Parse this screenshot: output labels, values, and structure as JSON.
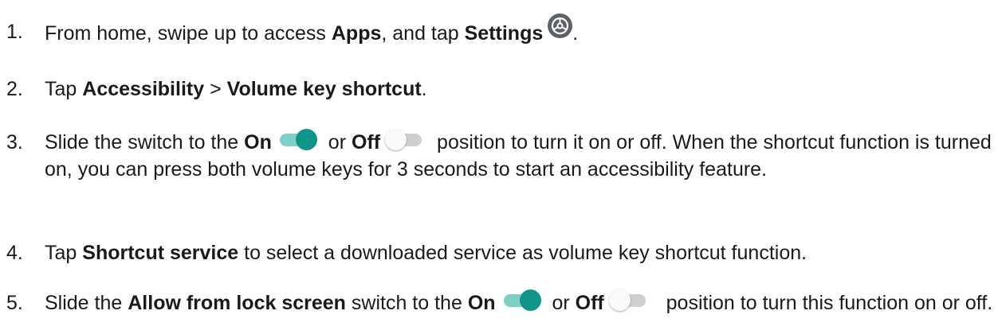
{
  "steps": [
    {
      "number": "1.",
      "t1": "From home, swipe up to access ",
      "b1": "Apps",
      "t2": ", and tap ",
      "b2": "Settings",
      "icon": "settings-gear-icon",
      "t3": "."
    },
    {
      "number": "2.",
      "t1": "Tap ",
      "b1": "Accessibility",
      "t2": " > ",
      "b2": "Volume key shortcut",
      "t3": "."
    },
    {
      "number": "3.",
      "t1": "Slide the switch to the ",
      "b1": "On",
      "t2": " or ",
      "b2": "Off",
      "t3": " position to turn it on or off. When the shortcut function is turned on, you can press both volume keys for 3 seconds to start an accessibility feature."
    },
    {
      "number": "4.",
      "t1": "Tap ",
      "b1": "Shortcut service",
      "t2": " to select a downloaded service as volume key shortcut function."
    },
    {
      "number": "5.",
      "t1": "Slide the ",
      "b1": "Allow from lock screen",
      "t2": " switch to the ",
      "b2": "On",
      "t3": " or ",
      "b3": "Off",
      "t4": "  position to turn this function on or off."
    }
  ],
  "colors": {
    "toggle_on_knob": "#0f9688",
    "toggle_on_track": "#7fcfc4",
    "toggle_off_track": "#cfcfcf",
    "settings_icon_bg": "#5e6268"
  }
}
